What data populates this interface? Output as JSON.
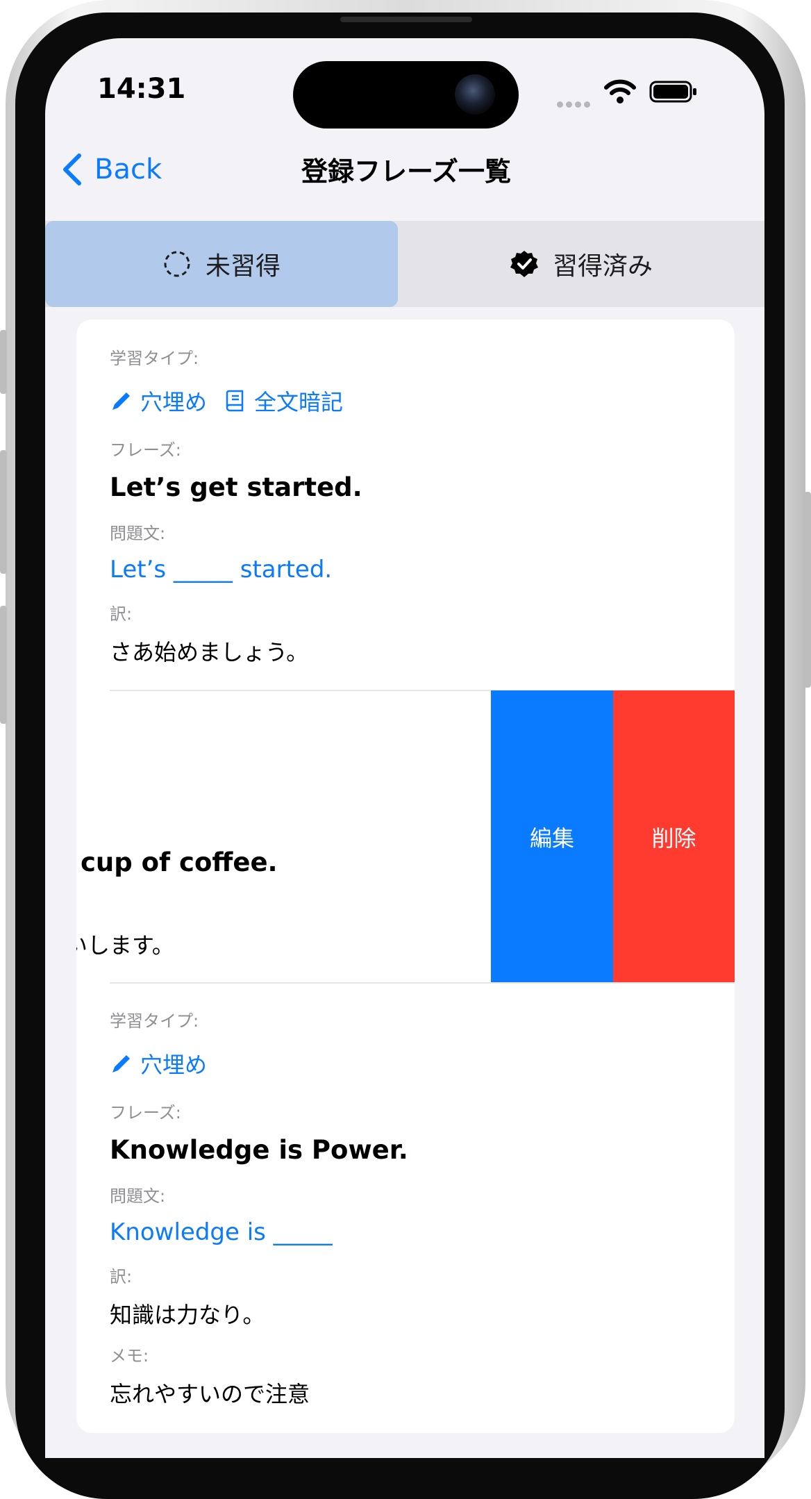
{
  "status_bar": {
    "time": "14:31"
  },
  "nav": {
    "back_label": "Back",
    "title": "登録フレーズ一覧"
  },
  "tabs": [
    {
      "label": "未習得",
      "icon": "dashed-circle-icon",
      "selected": true
    },
    {
      "label": "習得済み",
      "icon": "checkmark-seal-icon",
      "selected": false
    }
  ],
  "labels": {
    "study_type": "学習タイプ:",
    "phrase": "フレーズ:",
    "question": "問題文:",
    "translation": "訳:",
    "memo": "メモ:"
  },
  "study_types": {
    "fill_blank": "穴埋め",
    "full_memorize": "全文暗記"
  },
  "entries": [
    {
      "phrase": "Let’s get started.",
      "question": "Let’s _____ started.",
      "translation": "さあ始めましょう。"
    },
    {
      "phrase": " cup of coffee.",
      "translation": "いします。"
    },
    {
      "phrase": "Knowledge is Power.",
      "question": "Knowledge is _____",
      "translation": "知識は力なり。",
      "memo": "忘れやすいので注意"
    }
  ],
  "swipe_actions": {
    "edit": "編集",
    "delete": "削除"
  },
  "colors": {
    "accent": "#0A7AFF",
    "delete": "#FF3B30",
    "tab_selected": "#B1C9EA"
  }
}
